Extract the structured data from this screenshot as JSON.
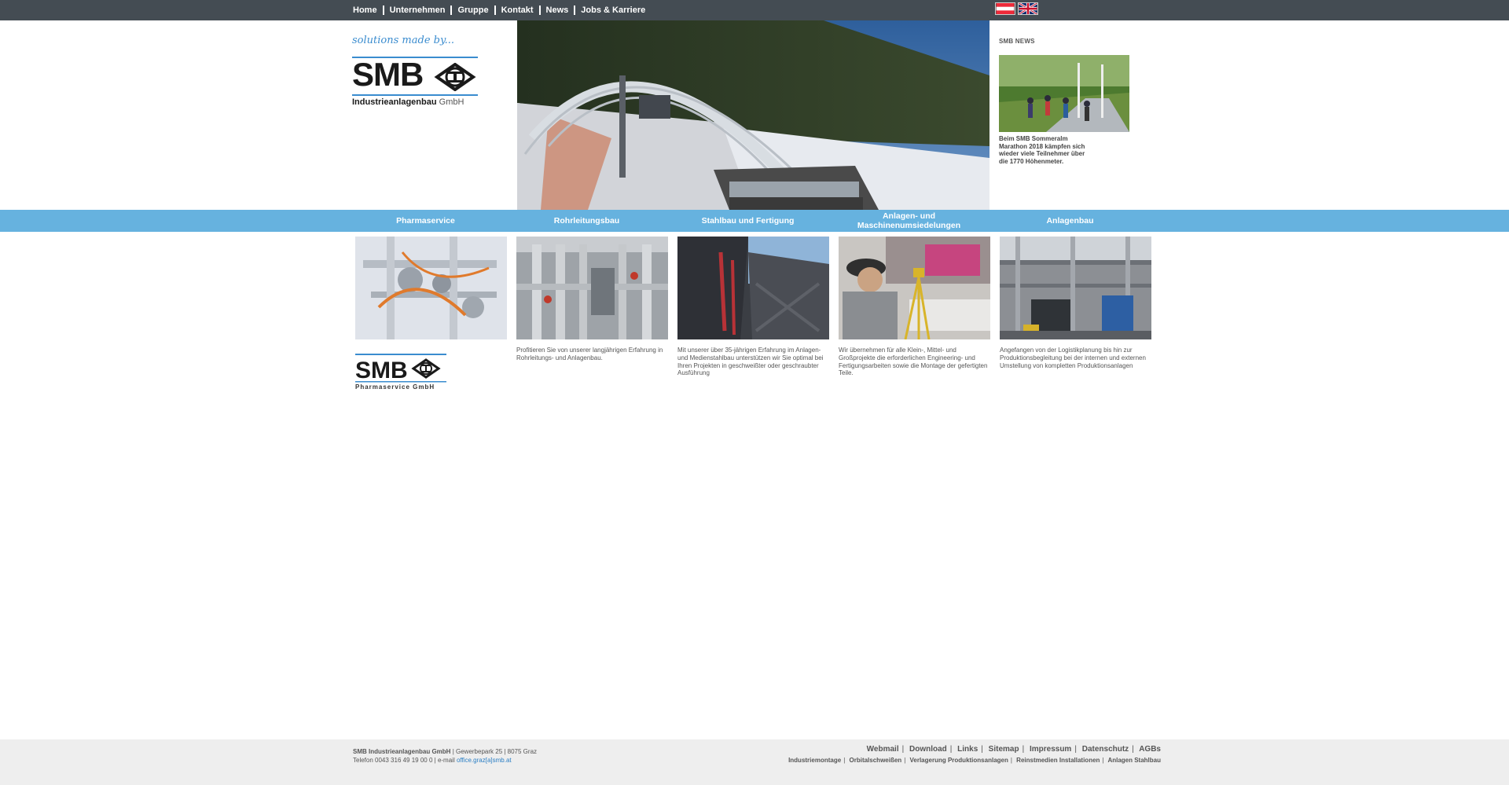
{
  "topnav": {
    "items": [
      "Home",
      "Unternehmen",
      "Gruppe",
      "Kontakt",
      "News",
      "Jobs & Karriere"
    ]
  },
  "flags": {
    "at": "austria-flag-icon",
    "en": "uk-flag-icon"
  },
  "logo": {
    "tagline": "solutions made by...",
    "word": "SMB",
    "sub_bold": "Industrieanlagenbau",
    "sub_light": "GmbH"
  },
  "news": {
    "title": "SMB NEWS",
    "text": "Beim SMB Sommeralm Marathon 2018 kämpfen sich wieder viele Teilnehmer über die 1770 Höhenmeter."
  },
  "categories": [
    "Pharmaservice",
    "Rohrleitungsbau",
    "Stahlbau und Fertigung",
    "Anlagen- und Maschinenumsiedelungen",
    "Anlagenbau"
  ],
  "cards": [
    {
      "text": ""
    },
    {
      "text": "Profitieren Sie von unserer langjährigen Erfahrung in Rohrleitungs- und Anlagenbau."
    },
    {
      "text": "Mit unserer über 35-jährigen Erfahrung im Anlagen- und Medienstahlbau unterstützen wir Sie optimal bei Ihren Projekten in geschweißter oder geschraubter Ausführung"
    },
    {
      "text": "Wir übernehmen für alle Klein-, Mittel- und Großprojekte die erforderlichen Engineering- und Fertigungsarbeiten sowie die Montage der gefertigten Teile."
    },
    {
      "text": "Angefangen von der Logistikplanung bis hin zur Produktionsbegleitung bei der internen und externen Umstellung von kompletten Produktionsanlagen"
    }
  ],
  "pharma_logo": {
    "word": "SMB",
    "sub": "Pharmaservice GmbH"
  },
  "footer": {
    "company": "SMB Industrieanlagenbau GmbH",
    "address": " | Gewerbepark 25 | 8075 Graz",
    "phone": "Telefon 0043 316 49 19 00 0 | e-mail ",
    "email": "office.graz[a]smb.at",
    "links": [
      "Webmail",
      "Download",
      "Links",
      "Sitemap",
      "Impressum",
      "Datenschutz",
      "AGBs"
    ],
    "sublinks": [
      "Industriemontage",
      "Orbitalschweißen",
      "Verlagerung Produktionsanlagen",
      "Reinstmedien Installationen",
      "Anlagen Stahlbau"
    ]
  },
  "colors": {
    "topbar": "#444c53",
    "category_bar": "#66b2df",
    "brand_blue": "#3a8ccf",
    "footer_bg": "#eeeeee"
  }
}
